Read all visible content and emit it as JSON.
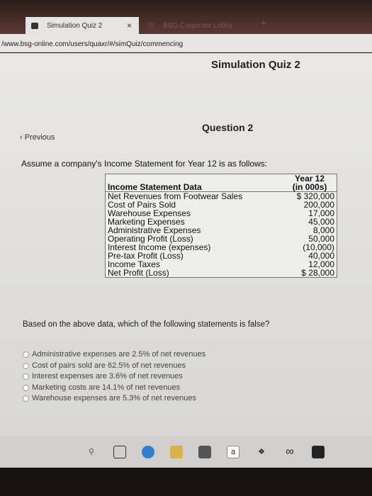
{
  "browser": {
    "tabs": [
      {
        "label": "Simulation Quiz 2",
        "active": true
      },
      {
        "label": "BSG Corporate Lobby",
        "active": false
      }
    ],
    "close_glyph": "×",
    "new_tab_glyph": "+",
    "url": "/www.bsg-online.com/users/quaxr/#/simQuiz/commencing"
  },
  "page": {
    "title": "Simulation Quiz 2",
    "question": "Question 2",
    "previous": "‹ Previous",
    "intro": "Assume a company's Income Statement for Year 12 is as follows:",
    "table": {
      "header_label": "Income Statement Data",
      "header_value_line1": "Year 12",
      "header_value_line2": "(in 000s)",
      "rows": [
        {
          "label": "Net Revenues from Footwear Sales",
          "value": "$ 320,000"
        },
        {
          "label": "Cost of Pairs Sold",
          "value": "200,000"
        },
        {
          "label": "Warehouse Expenses",
          "value": "17,000"
        },
        {
          "label": "Marketing Expenses",
          "value": "45,000"
        },
        {
          "label": "Administrative Expenses",
          "value": "8,000"
        },
        {
          "label": "Operating Profit (Loss)",
          "value": "50,000"
        },
        {
          "label": "Interest Income (expenses)",
          "value": "(10,000)"
        },
        {
          "label": "Pre-tax Profit (Loss)",
          "value": "40,000"
        },
        {
          "label": "Income Taxes",
          "value": "12,000"
        },
        {
          "label": "Net Profit (Loss)",
          "value": "$ 28,000"
        }
      ]
    },
    "prompt": "Based on the above data, which of the following statements is false?",
    "options": [
      "Administrative expenses are 2.5% of net revenues",
      "Cost of pairs sold are 62.5% of net revenues",
      "Interest expenses are 3.6% of net revenues",
      "Marketing costs are 14.1% of net revenues",
      "Warehouse expenses are 5.3% of net revenues"
    ]
  },
  "taskbar": {
    "icons": [
      "search-icon",
      "task-view-icon",
      "edge-icon",
      "file-explorer-icon",
      "store-icon",
      "amazon-icon",
      "dropbox-icon",
      "infinity-icon",
      "mail-icon"
    ],
    "amazon_letter": "a",
    "infinity_glyph": "∞"
  }
}
